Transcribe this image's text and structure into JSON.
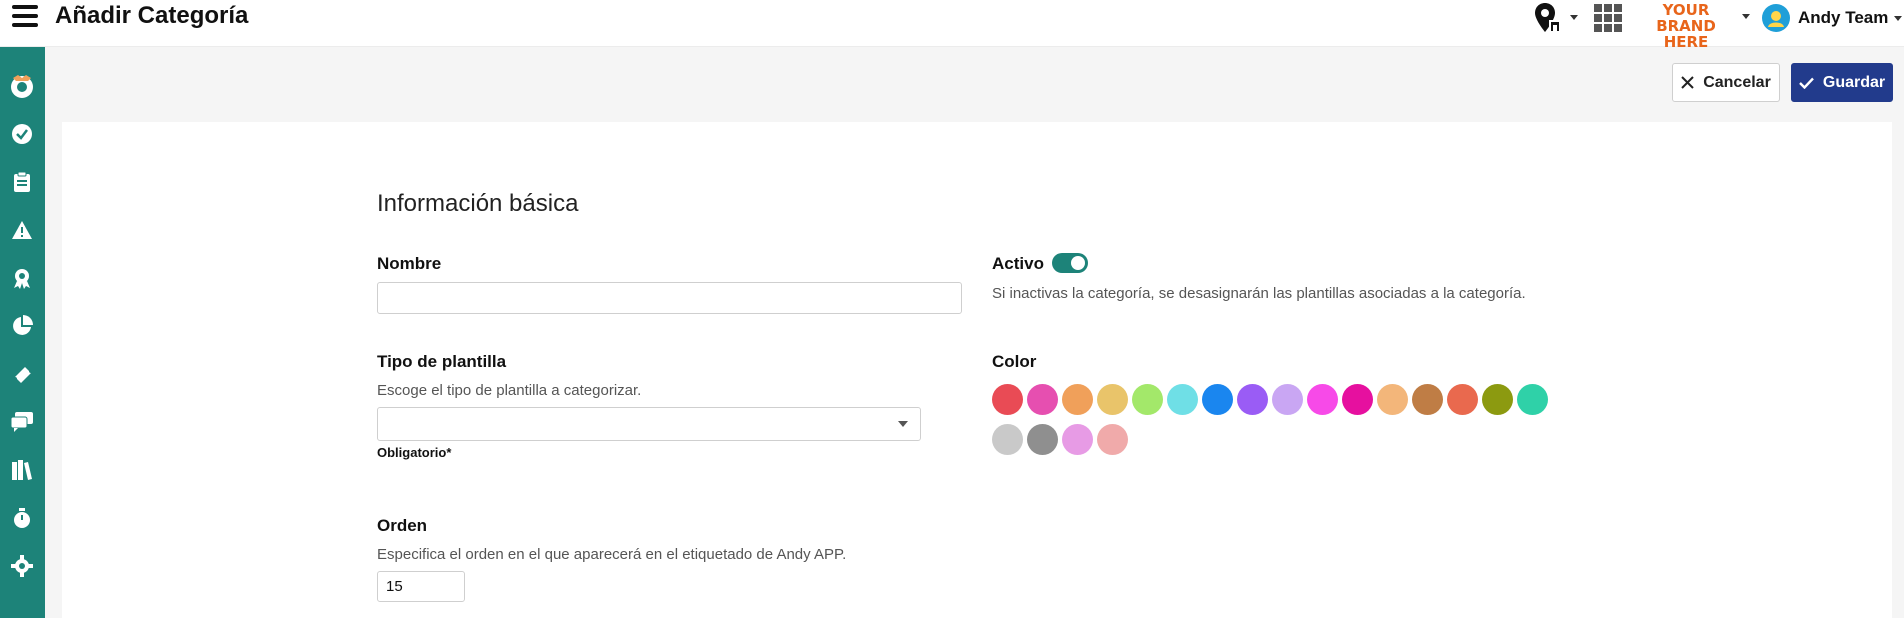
{
  "header": {
    "title": "Añadir Categoría",
    "brand_text": "YOUR BRAND HERE",
    "user_name": "Andy Team"
  },
  "actions": {
    "cancel_label": "Cancelar",
    "save_label": "Guardar"
  },
  "form": {
    "section_title": "Información básica",
    "name": {
      "label": "Nombre",
      "value": ""
    },
    "active": {
      "label": "Activo",
      "enabled": true,
      "hint": "Si inactivas la categoría, se desasignarán las plantillas asociadas a la categoría."
    },
    "template_type": {
      "label": "Tipo de plantilla",
      "hint": "Escoge el tipo de plantilla a categorizar.",
      "value": "",
      "required_text": "Obligatorio*"
    },
    "color": {
      "label": "Color",
      "swatches": [
        "#e94b55",
        "#e64fb0",
        "#f0a05a",
        "#e9c46a",
        "#a3e86a",
        "#6fdfe6",
        "#1a86ef",
        "#9a5cf5",
        "#c9a6f3",
        "#f74ae8",
        "#e6109f",
        "#f3b67a",
        "#bf7d45",
        "#e9694e",
        "#8c9a10",
        "#2fd1a8",
        "#c9c9c9",
        "#8f8f8f",
        "#e79be5",
        "#f0aaaa"
      ]
    },
    "order": {
      "label": "Orden",
      "hint": "Especifica el orden en el que aparecerá en el etiquetado de Andy APP.",
      "value": "15"
    }
  },
  "colors": {
    "accent": "#1d8379",
    "primary": "#223b8c",
    "brand": "#e8651b"
  },
  "sidebar": {
    "items": [
      {
        "icon": "profile-icon"
      },
      {
        "icon": "check-circle-icon"
      },
      {
        "icon": "clipboard-icon"
      },
      {
        "icon": "warning-icon"
      },
      {
        "icon": "award-icon"
      },
      {
        "icon": "pie-chart-icon"
      },
      {
        "icon": "ticket-icon"
      },
      {
        "icon": "chat-icon"
      },
      {
        "icon": "library-icon"
      },
      {
        "icon": "stopwatch-icon"
      },
      {
        "icon": "settings-icon"
      }
    ]
  }
}
